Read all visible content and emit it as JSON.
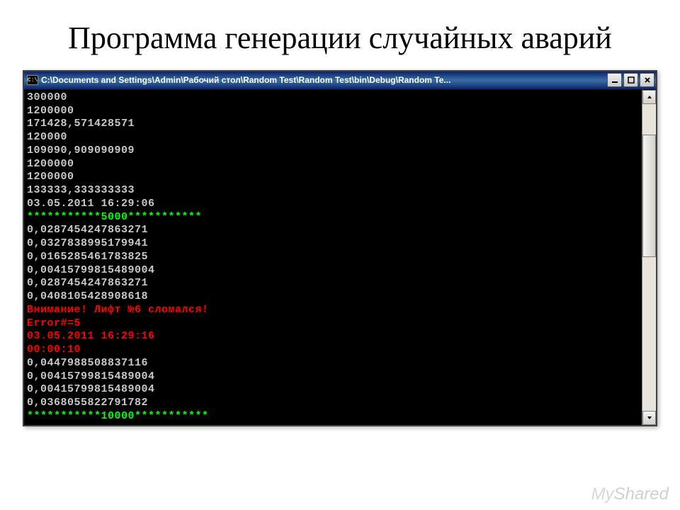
{
  "slide": {
    "title": "Программа генерации случайных аварий"
  },
  "window": {
    "icon_text": "C:\\",
    "title": "C:\\Documents and Settings\\Admin\\Рабочий стол\\Random Test\\Random Test\\bin\\Debug\\Random Te..."
  },
  "console": {
    "lines": [
      {
        "text": "300000",
        "color": "white"
      },
      {
        "text": "1200000",
        "color": "white"
      },
      {
        "text": "171428,571428571",
        "color": "white"
      },
      {
        "text": "120000",
        "color": "white"
      },
      {
        "text": "109090,909090909",
        "color": "white"
      },
      {
        "text": "1200000",
        "color": "white"
      },
      {
        "text": "1200000",
        "color": "white"
      },
      {
        "text": "133333,333333333",
        "color": "white"
      },
      {
        "text": "03.05.2011 16:29:06",
        "color": "white"
      },
      {
        "text": "***********5000***********",
        "color": "green"
      },
      {
        "text": "0,0287454247863271",
        "color": "white"
      },
      {
        "text": "0,0327838995179941",
        "color": "white"
      },
      {
        "text": "0,0165285461783825",
        "color": "white"
      },
      {
        "text": "0,00415799815489004",
        "color": "white"
      },
      {
        "text": "0,0287454247863271",
        "color": "white"
      },
      {
        "text": "0,0408105428908618",
        "color": "white"
      },
      {
        "text": "Внимание! Лифт №6 сломался!",
        "color": "red"
      },
      {
        "text": "Error#=5",
        "color": "red"
      },
      {
        "text": "03.05.2011 16:29:16",
        "color": "red"
      },
      {
        "text": "00:00:10",
        "color": "red"
      },
      {
        "text": "0,0447988508837116",
        "color": "white"
      },
      {
        "text": "0,00415799815489004",
        "color": "white"
      },
      {
        "text": "0,00415799815489004",
        "color": "white"
      },
      {
        "text": "0,0368055822791782",
        "color": "white"
      },
      {
        "text": "***********10000***********",
        "color": "green"
      }
    ]
  },
  "watermark": {
    "part1": "My",
    "part2": "Shared"
  }
}
